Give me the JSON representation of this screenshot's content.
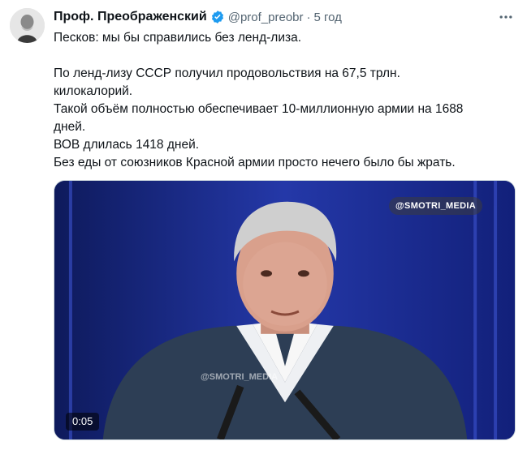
{
  "tweet": {
    "author": {
      "display_name": "Проф. Преображенский",
      "handle": "@prof_preobr",
      "separator": "·",
      "time": "5 год",
      "verified": true,
      "avatar_icon": "portrait-avatar"
    },
    "text_lines": [
      "Песков: мы бы справились без ленд-лиза.",
      "",
      "По ленд-лизу СССР получил продовольствия на 67,5 трлн.",
      "килокалорий.",
      "Такой объём полностью обеспечивает 10-миллионную армии на 1688",
      "дней.",
      "ВОВ длилась 1418 дней.",
      "Без еды от союзников Красной армии просто нечего было бы жрать."
    ],
    "media": {
      "type": "video",
      "watermark_pill": "@SMOTRI_MEDIA",
      "watermark_center": "@SMOTRI_MEDIA",
      "duration": "0:05"
    },
    "more_icon": "more-horizontal-icon"
  },
  "colors": {
    "text": "#0f1419",
    "secondary": "#536471",
    "verified": "#1d9bf0",
    "video_bg": "#1b2a78"
  }
}
